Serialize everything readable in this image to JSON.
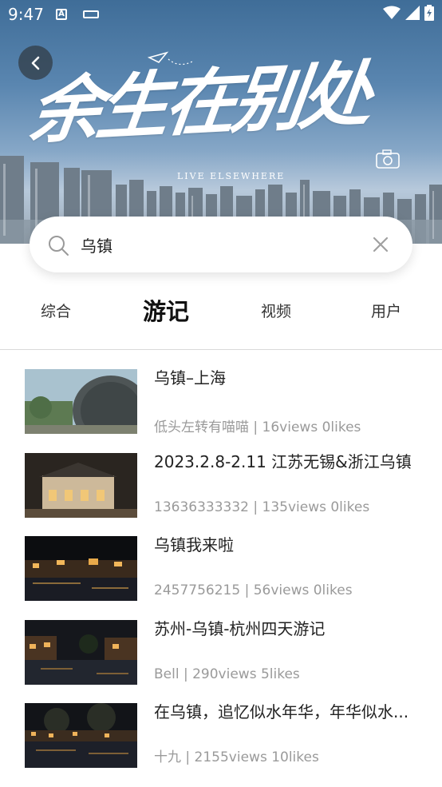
{
  "status_bar": {
    "time": "9:47",
    "a_icon": "A"
  },
  "banner": {
    "title": "余生在别处",
    "subtitle": "LIVE ELSEWHERE"
  },
  "search": {
    "value": "乌镇"
  },
  "tabs": [
    {
      "label": "综合",
      "active": false
    },
    {
      "label": "游记",
      "active": true
    },
    {
      "label": "视频",
      "active": false
    },
    {
      "label": "用户",
      "active": false
    }
  ],
  "results": [
    {
      "title": "乌镇–上海",
      "meta": "低头左转有喵喵 | 16views 0likes",
      "thumb": "day-stone"
    },
    {
      "title": "2023.2.8-2.11  江苏无锡&浙江乌镇",
      "meta": "13636333332 | 135views 0likes",
      "thumb": "night-building"
    },
    {
      "title": "乌镇我来啦",
      "meta": "2457756215 | 56views 0likes",
      "thumb": "night-river"
    },
    {
      "title": "苏州-乌镇-杭州四天游记",
      "meta": "Bell | 290views 5likes",
      "thumb": "night-canal"
    },
    {
      "title": "在乌镇，追忆似水年华，年华似水...",
      "meta": "十九 | 2155views 10likes",
      "thumb": "night-trees"
    }
  ],
  "colors": {
    "accent_text": "#111111",
    "meta_text": "#9a9a9a"
  }
}
